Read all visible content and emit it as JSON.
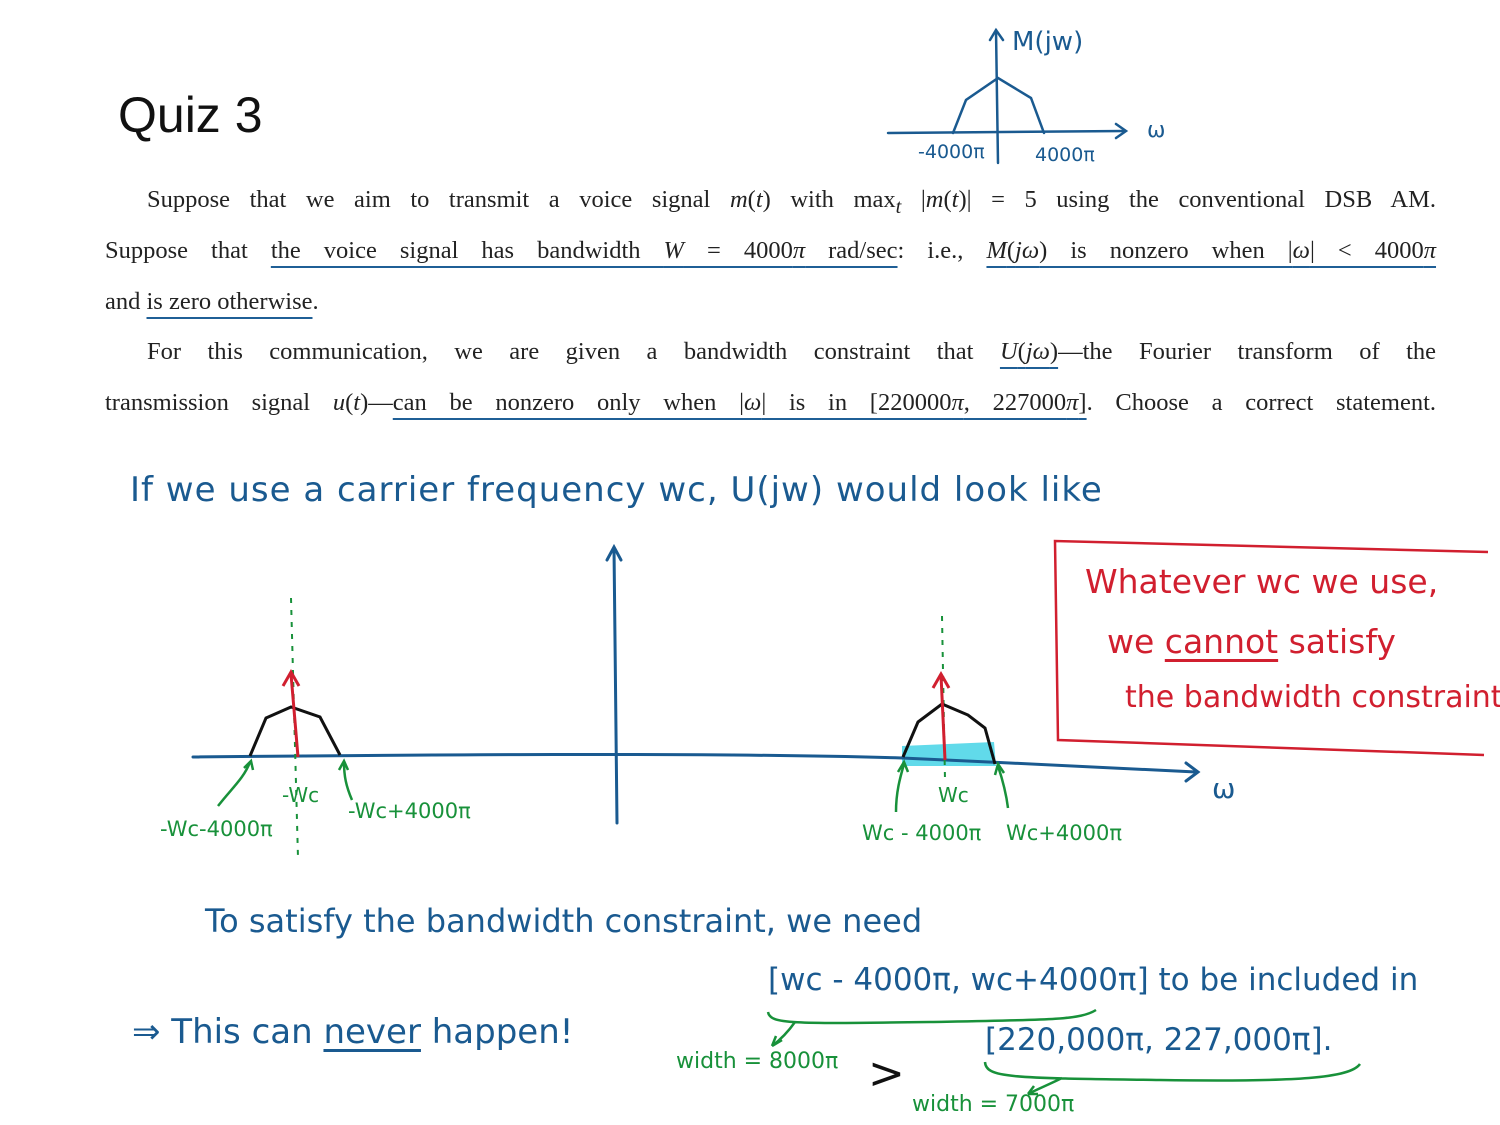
{
  "title": "Quiz 3",
  "problem": {
    "p1_l1": [
      "Suppose that we aim to transmit a voice signal ",
      "m",
      "(",
      "t",
      ") with max",
      "t",
      " |",
      "m",
      "(",
      "t",
      ")| = 5 using the conventional DSB AM."
    ],
    "p1_l2": [
      "Suppose that ",
      "the voice signal has bandwidth ",
      "W",
      " = 4000",
      "π",
      " rad/sec",
      ": i.e., ",
      "M",
      "(",
      "jω",
      ") is nonzero when |",
      "ω",
      "| < 4000",
      "π"
    ],
    "p1_l3": [
      "and ",
      "is zero otherwise",
      "."
    ],
    "p2_l1": [
      "For this communication, we are given a bandwidth constraint that ",
      "U",
      "(",
      "jω",
      ")",
      "—the Fourier transform of the"
    ],
    "p2_l2": [
      "transmission signal ",
      "u",
      "(",
      "t",
      ")—",
      "can be nonzero only when |",
      "ω",
      "| is in [220000",
      "π",
      ", 227000",
      "π",
      "]",
      ". Choose a correct statement."
    ]
  },
  "sketch_top": {
    "ylabel": "M(jw)",
    "xlabel": "ω",
    "left_tick": "-4000π",
    "right_tick": "4000π"
  },
  "notes": {
    "intro": "If we use a carrier frequency wc, U(jw) would look like",
    "need": "To satisfy the bandwidth constraint, we need",
    "interval_a": "[wc - 4000π, wc+4000π] to be included in",
    "interval_b": "[220,000π, 227,000π].",
    "width_a": "width = 8000π",
    "width_b": "width = 7000π",
    "greater": ">",
    "never_pre": "⇒ This can ",
    "never_word": "never",
    "never_post": " happen!"
  },
  "spectrum": {
    "xlabel": "ω",
    "neg_center": "-Wc",
    "neg_low": "-Wc-4000π",
    "neg_high": "-Wc+4000π",
    "pos_center": "Wc",
    "pos_low": "Wc - 4000π",
    "pos_high": "Wc+4000π"
  },
  "callout": {
    "line1": "Whatever wc we use,",
    "line2a": "we ",
    "line2b": "cannot",
    "line2c": " satisfy",
    "line3": "the bandwidth constraint."
  },
  "colors": {
    "ink_blue": "#1a5a90",
    "ink_green": "#18913a",
    "ink_red": "#d11f2f",
    "highlight": "#45d4e6"
  }
}
